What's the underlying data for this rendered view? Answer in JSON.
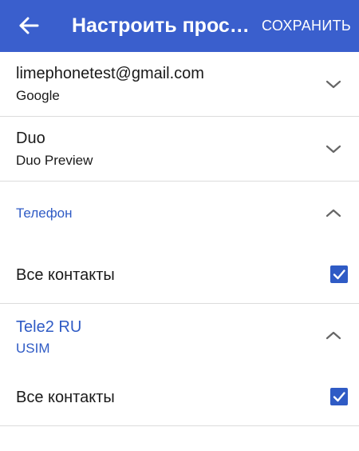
{
  "appbar": {
    "title": "Настроить просм...",
    "save_label": "СОХРАНИТЬ",
    "back_icon": "arrow-left-icon",
    "background": "#3a5fcd"
  },
  "accounts": [
    {
      "name": "limephonetest@gmail.com",
      "subtitle": "Google",
      "expanded": false
    },
    {
      "name": "Duo",
      "subtitle": "Duo Preview",
      "expanded": false
    }
  ],
  "phone_section": {
    "title": "Телефон",
    "expanded": true,
    "option_label": "Все контакты",
    "checked": true
  },
  "sim_section": {
    "title": "Tele2 RU",
    "subtitle": "USIM",
    "expanded": true,
    "option_label": "Все контакты",
    "checked": true
  },
  "accent_color": "#2f5bc5"
}
